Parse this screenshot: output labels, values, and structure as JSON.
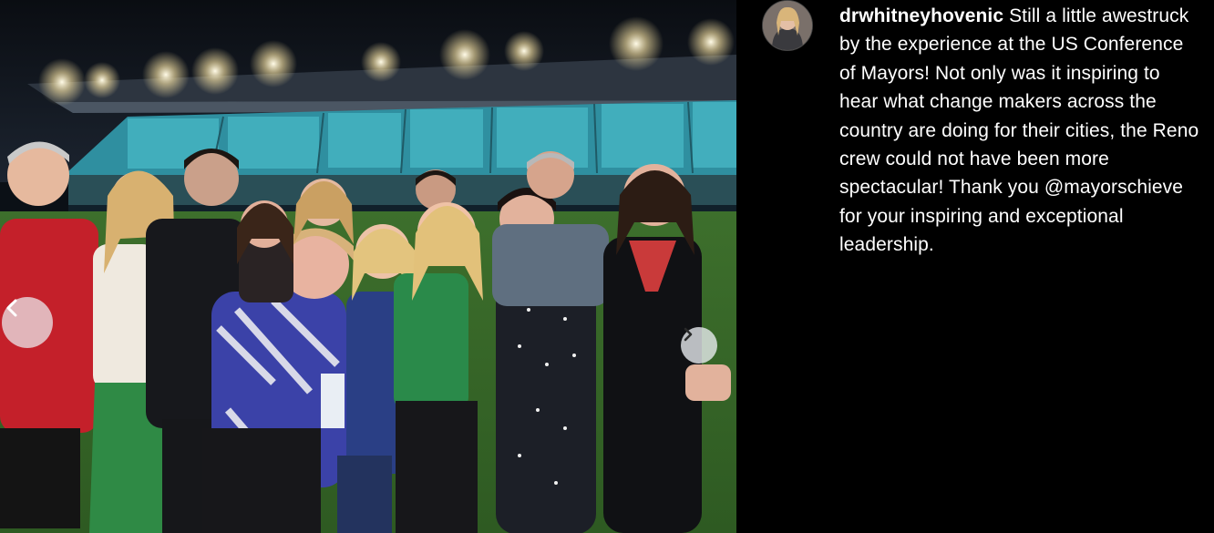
{
  "post": {
    "username": "drwhitneyhovenic",
    "caption": "Still a little awestruck by the experience at the US Conference of Mayors! Not only was it inspiring to hear what change makers across the country are doing for their cities, the Reno crew could not have been more spectacular! Thank you @mayorschieve for your inspiring and exceptional leadership."
  },
  "carousel": {
    "prev_icon": "chevron-left-icon",
    "next_icon": "chevron-right-icon"
  },
  "colors": {
    "background": "#000000",
    "text": "#ffffff",
    "stadium_seats": "#3aa6b4",
    "field": "#3f7a2e"
  }
}
